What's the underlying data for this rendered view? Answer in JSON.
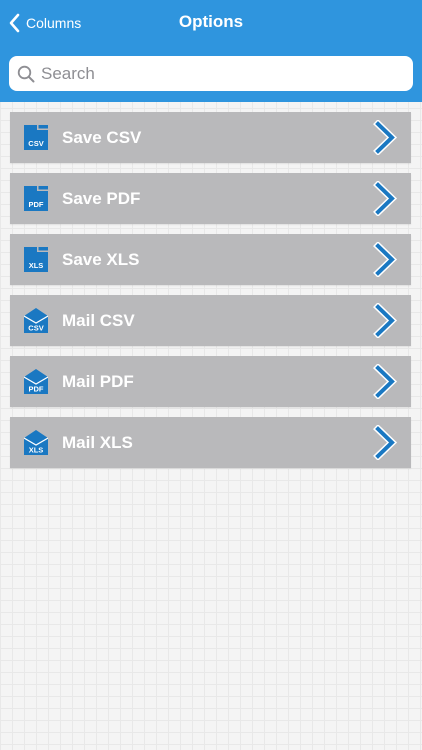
{
  "nav": {
    "back_label": "Columns",
    "title": "Options"
  },
  "search": {
    "placeholder": "Search",
    "value": ""
  },
  "options": [
    {
      "label": "Save CSV",
      "icon": "save-csv-icon",
      "badge": "CSV"
    },
    {
      "label": "Save PDF",
      "icon": "save-pdf-icon",
      "badge": "PDF"
    },
    {
      "label": "Save XLS",
      "icon": "save-xls-icon",
      "badge": "XLS"
    },
    {
      "label": "Mail CSV",
      "icon": "mail-csv-icon",
      "badge": "CSV"
    },
    {
      "label": "Mail PDF",
      "icon": "mail-pdf-icon",
      "badge": "PDF"
    },
    {
      "label": "Mail XLS",
      "icon": "mail-xls-icon",
      "badge": "XLS"
    }
  ],
  "colors": {
    "header": "#2f95de",
    "row": "#b9b9bb",
    "icon": "#1a78c2",
    "chevron": "#1a78c2"
  }
}
